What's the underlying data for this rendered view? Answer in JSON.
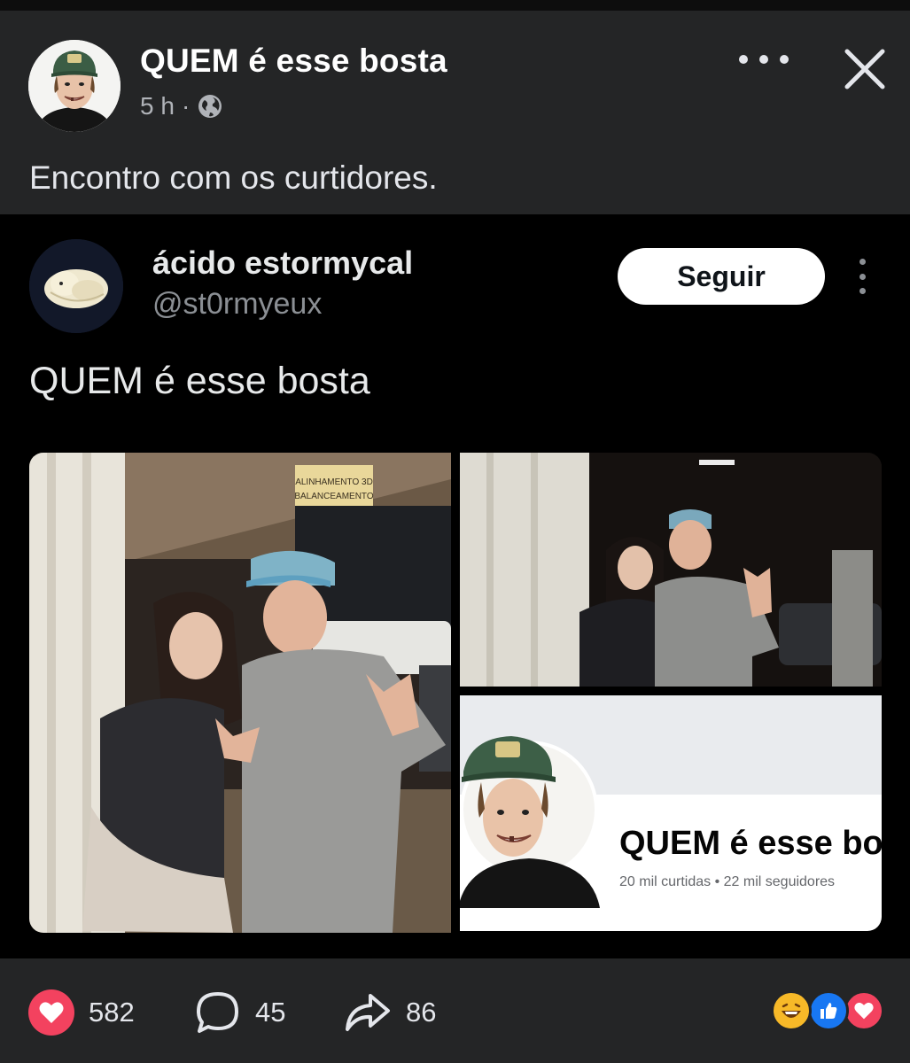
{
  "post": {
    "author": "QUEM é esse bosta",
    "time": "5 h",
    "separator": "·",
    "caption": "Encontro com os curtidores.",
    "audience_icon": "globe-icon",
    "menu_icon": "more-horizontal-icon",
    "close_icon": "close-icon"
  },
  "tweet": {
    "display_name": "ácido estormycal",
    "handle": "@st0rmyeux",
    "follow_label": "Seguir",
    "text": "QUEM é esse bosta",
    "more_icon": "more-vertical-icon",
    "images": {
      "sign_text": [
        "ALINHAMENTO 3D",
        "BALANCEAMENTO"
      ],
      "profile_card": {
        "page_name": "QUEM é esse bosta",
        "stats": "20 mil curtidas • 22 mil seguidores"
      }
    }
  },
  "actions": {
    "likes": "582",
    "comments": "45",
    "shares": "86",
    "like_icon": "heart-icon",
    "comment_icon": "comment-bubble-icon",
    "share_icon": "share-arrow-icon",
    "reactions": [
      "haha-emoji-icon",
      "like-thumb-icon",
      "love-heart-icon"
    ]
  },
  "colors": {
    "facebook_bg": "#242526",
    "tweet_bg": "#000000",
    "love_red": "#f3425f",
    "like_blue": "#1877f2",
    "haha_yellow": "#f7b928"
  }
}
